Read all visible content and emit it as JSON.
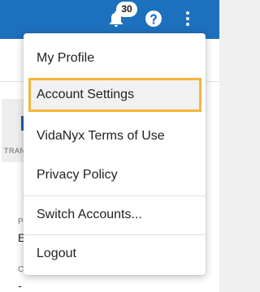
{
  "header": {
    "notification_count": "30",
    "icons": [
      "bell-icon",
      "help-icon",
      "more-vertical-icon"
    ],
    "colors": {
      "bar": "#1d70bd",
      "badge_bg": "#ffffff"
    }
  },
  "background": {
    "tab_label": "TRAN",
    "field1_label": "P",
    "field1_value": "E",
    "field2_label": "C",
    "field2_value": "-"
  },
  "menu": {
    "items": [
      {
        "label": "My Profile"
      },
      {
        "label": "Account Settings",
        "highlighted": true
      },
      {
        "label": "VidaNyx Terms of Use"
      },
      {
        "label": "Privacy Policy"
      },
      {
        "label": "Switch Accounts..."
      },
      {
        "label": "Logout"
      }
    ],
    "highlight_color": "#f4b73a"
  }
}
